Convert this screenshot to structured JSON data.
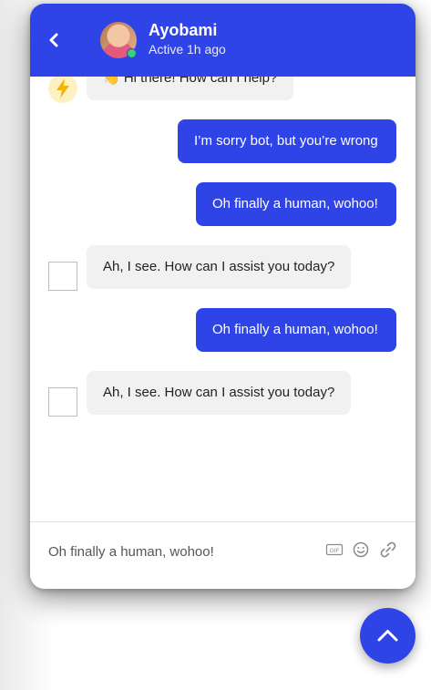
{
  "header": {
    "agent_name": "Ayobami",
    "agent_status": "Active 1h ago"
  },
  "messages": [
    {
      "sender": "bot",
      "text": "👋 Hi there! How can I help?"
    },
    {
      "sender": "user",
      "text": "I’m sorry bot, but you’re wrong"
    },
    {
      "sender": "user",
      "text": "Oh finally a human, wohoo!"
    },
    {
      "sender": "agent",
      "text": "Ah, I see. How can I assist you today?"
    },
    {
      "sender": "user",
      "text": "Oh finally a human, wohoo!"
    },
    {
      "sender": "agent",
      "text": "Ah, I see. How can I assist you today?"
    }
  ],
  "composer": {
    "value": "Oh finally a human, wohoo!",
    "gif_label": "GIF"
  },
  "colors": {
    "accent": "#2f44e6",
    "bot_bubble": "#f1f1f1",
    "online": "#3bd16f"
  },
  "icons": {
    "back": "chevron-left-icon",
    "bolt": "lightning-bolt-icon",
    "gif": "gif-icon",
    "emoji": "emoji-icon",
    "attach": "link-icon",
    "scroll": "chevron-up-icon"
  }
}
